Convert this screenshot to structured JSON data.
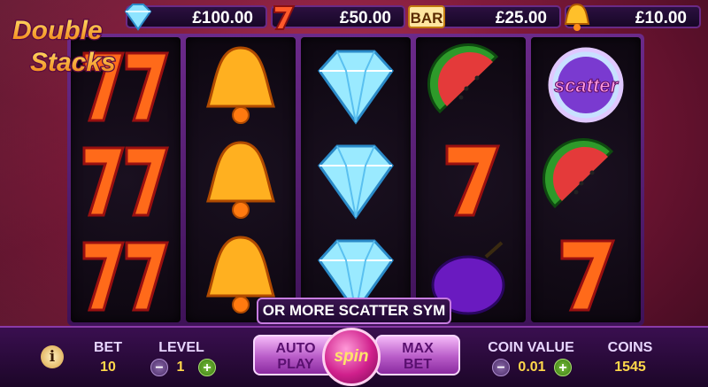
{
  "logo": {
    "text_line1": "Double",
    "text_line2": "Stacks"
  },
  "paytable": [
    {
      "symbol": "diamond-icon",
      "value": "£100.00"
    },
    {
      "symbol": "seven-icon",
      "value": "£50.00"
    },
    {
      "symbol": "bar-icon",
      "symbol_text": "BAR",
      "value": "£25.00"
    },
    {
      "symbol": "bell-icon",
      "value": "£10.00"
    }
  ],
  "reels": [
    [
      "seven-icon",
      "seven-icon",
      "seven-icon"
    ],
    [
      "bell-icon",
      "bell-icon",
      "bell-icon"
    ],
    [
      "diamond-icon",
      "diamond-icon",
      "diamond-icon"
    ],
    [
      "watermelon-icon",
      "seven-icon",
      "plum-icon"
    ],
    [
      "scatter-icon",
      "watermelon-icon",
      "seven-icon"
    ]
  ],
  "scatter_text": "scatter",
  "message": "OR MORE SCATTER SYM",
  "controls": {
    "info_label": "i",
    "bet_label": "BET",
    "bet_value": "10",
    "level_label": "LEVEL",
    "level_value": "1",
    "auto_play_line1": "AUTO",
    "auto_play_line2": "PLAY",
    "spin_label": "spin",
    "max_bet_line1": "MAX",
    "max_bet_line2": "BET",
    "coin_value_label": "COIN VALUE",
    "coin_value": "0.01",
    "coins_label": "COINS",
    "coins_value": "1545",
    "minus": "−",
    "plus": "+"
  },
  "colors": {
    "accent_gold": "#ffd84a",
    "frame_purple": "#6b2a8a",
    "background_red": "#a02a4a"
  }
}
